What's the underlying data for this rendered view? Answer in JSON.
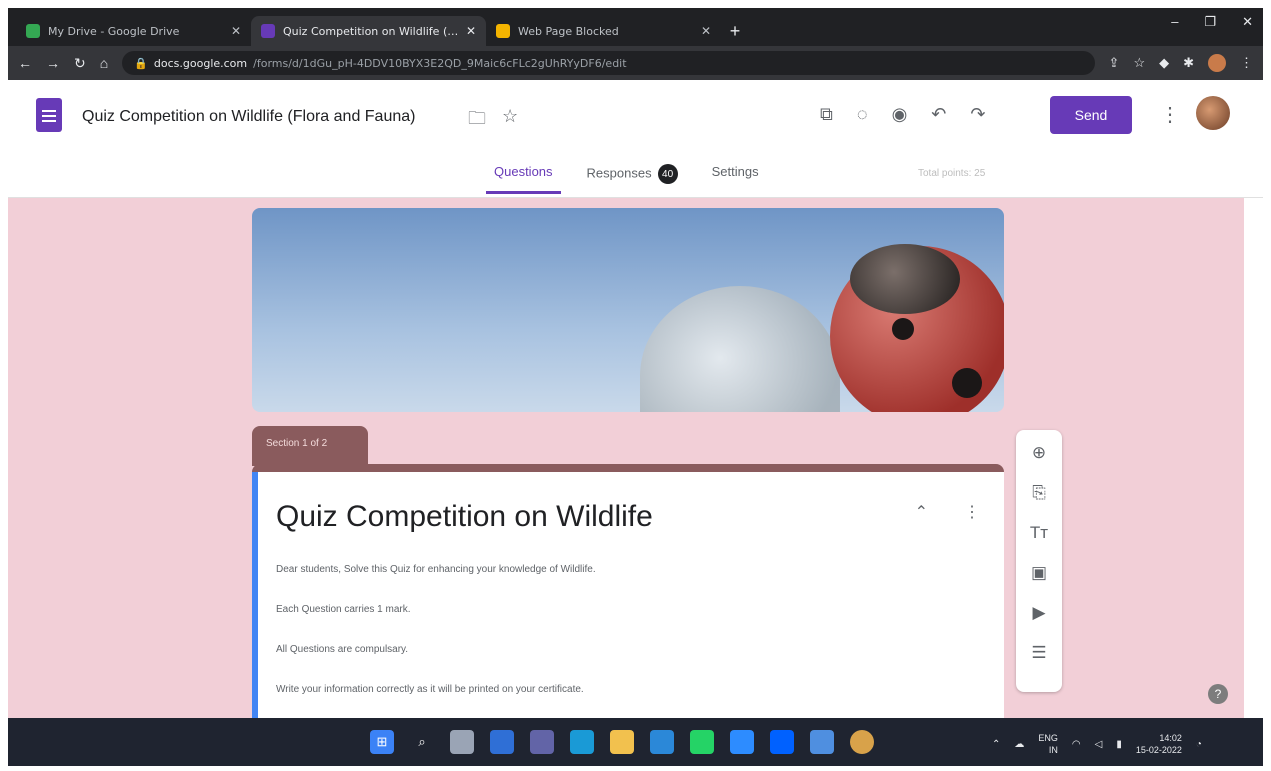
{
  "browser": {
    "tabs": [
      {
        "title": "My Drive - Google Drive",
        "favicon_color": "#34a853",
        "active": false
      },
      {
        "title": "Quiz Competition on Wildlife (Fl...",
        "favicon_color": "#673ab7",
        "active": true
      },
      {
        "title": "Web Page Blocked",
        "favicon_color": "#f4b400",
        "active": false
      }
    ],
    "new_tab": "+",
    "url_domain": "docs.google.com",
    "url_path": "/forms/d/1dGu_pH-4DDV10BYX3E2QD_9Maic6cFLc2gUhRYyDF6/edit",
    "window_controls": [
      "–",
      "❐",
      "✕"
    ]
  },
  "header": {
    "form_title": "Quiz Competition on Wildlife (Flora and Fauna)",
    "send_label": "Send",
    "tabs": {
      "questions": "Questions",
      "responses": "Responses",
      "responses_count": "40",
      "settings": "Settings"
    },
    "total_points": "Total points: 25"
  },
  "section": {
    "label": "Section 1 of 2",
    "title": "Quiz Competition on Wildlife",
    "description": [
      "Dear students, Solve this Quiz for enhancing your knowledge of Wildlife.",
      "Each Question carries 1 mark.",
      "All Questions are compulsary.",
      "Write your information correctly as it will be printed  on your certificate."
    ]
  },
  "toolbar_icons": [
    "add-question-icon",
    "import-questions-icon",
    "add-title-icon",
    "add-image-icon",
    "add-video-icon",
    "add-section-icon"
  ],
  "taskbar": {
    "tray_lang_1": "ENG",
    "tray_lang_2": "IN",
    "time": "14:02",
    "date": "15-02-2022"
  },
  "colors": {
    "accent": "#673ab7",
    "canvas": "#f2cfd7",
    "section": "#8a5b5d"
  }
}
